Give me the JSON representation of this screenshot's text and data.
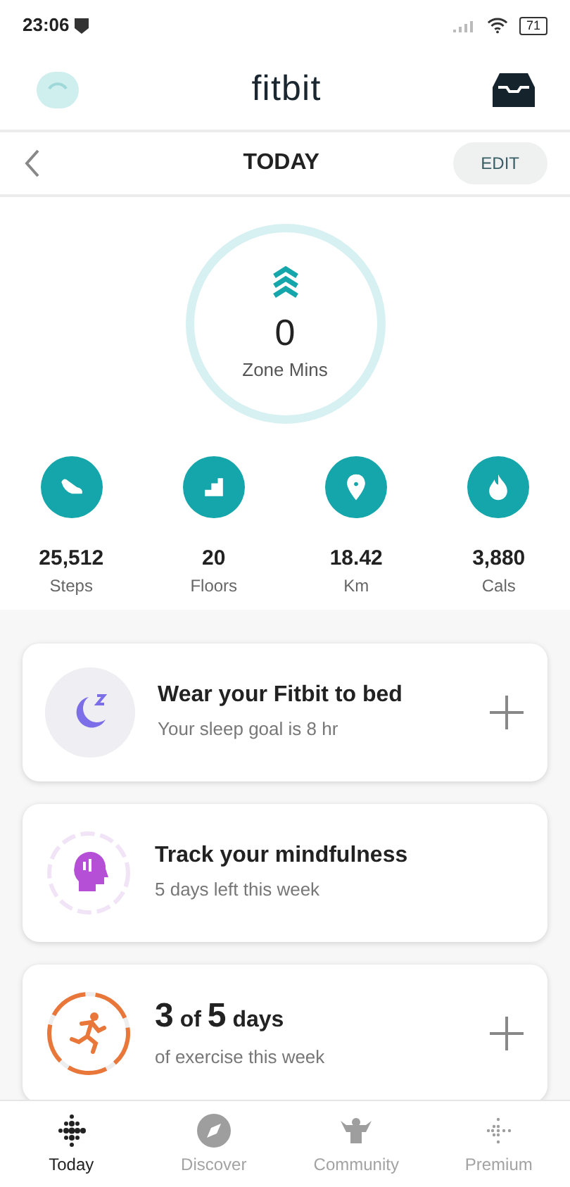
{
  "status_bar": {
    "time": "23:06",
    "battery": "71"
  },
  "header": {
    "logo": "fitbit"
  },
  "day_bar": {
    "title": "TODAY",
    "edit": "EDIT"
  },
  "zone": {
    "value": "0",
    "label": "Zone Mins",
    "level": 0
  },
  "stats": [
    {
      "kind": "steps",
      "value": "25,512",
      "label": "Steps"
    },
    {
      "kind": "floors",
      "value": "20",
      "label": "Floors"
    },
    {
      "kind": "distance",
      "value": "18.42",
      "label": "Km"
    },
    {
      "kind": "calories",
      "value": "3,880",
      "label": "Cals"
    }
  ],
  "cards": [
    {
      "kind": "sleep",
      "title": "Wear your Fitbit to bed",
      "subtitle": "Your sleep goal is 8 hr",
      "has_add": true
    },
    {
      "kind": "mindfulness",
      "title": "Track your mindfulness",
      "subtitle": "5 days left this week",
      "has_add": false
    },
    {
      "kind": "exercise",
      "done": "3",
      "connector": "of",
      "target": "5",
      "unit": "days",
      "subtitle": "of exercise this week",
      "has_add": true
    }
  ],
  "tabs": [
    {
      "kind": "today",
      "label": "Today",
      "selected": true
    },
    {
      "kind": "discover",
      "label": "Discover",
      "selected": false
    },
    {
      "kind": "community",
      "label": "Community",
      "selected": false
    },
    {
      "kind": "premium",
      "label": "Premium",
      "selected": false
    }
  ]
}
